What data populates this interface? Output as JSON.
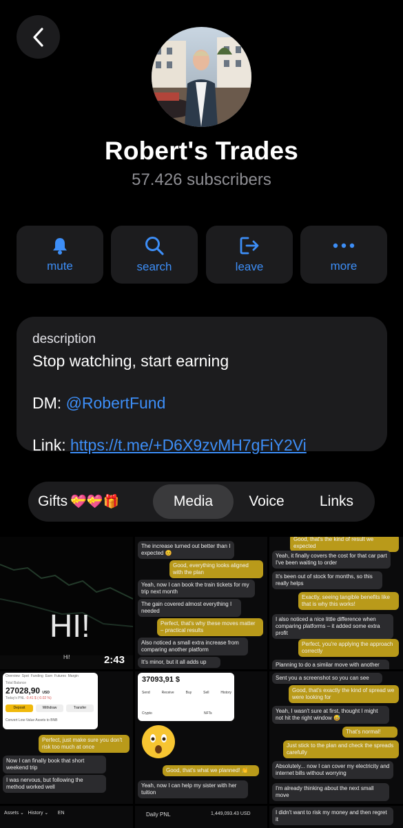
{
  "header": {
    "back_icon": "chevron-left-icon",
    "channel_name": "Robert's Trades",
    "subscribers": "57.426 subscribers"
  },
  "actions": [
    {
      "label": "mute",
      "icon": "bell-icon"
    },
    {
      "label": "search",
      "icon": "search-icon"
    },
    {
      "label": "leave",
      "icon": "leave-icon"
    },
    {
      "label": "more",
      "icon": "more-dots-icon"
    }
  ],
  "description": {
    "label": "description",
    "text": "Stop watching, start earning",
    "dm_label": "DM: ",
    "dm_handle": "@RobertFund",
    "link_label": "Link: ",
    "link_url": "https://t.me/+D6X9zvMH7gFiY2Vi"
  },
  "tabs": {
    "gifts": "Gifts",
    "gifts_emoji": "💝💝🎁",
    "media": "Media",
    "voice": "Voice",
    "links": "Links",
    "active": "Media"
  },
  "media": {
    "video": {
      "overlay_text": "HI!",
      "caption": "Hi!",
      "duration": "2:43"
    },
    "chat1": [
      "The increase turned out better than I expected 😊",
      "Good, everything looks aligned with the plan",
      "Yeah, now I can book the train tickets for my trip next month",
      "The gain covered almost everything I needed",
      "Perfect, that's why these moves matter – practical results",
      "Also noticed a small extra increase from comparing another platform",
      "It's minor, but it all adds up"
    ],
    "chat2": [
      "Good, that's the kind of result we expected",
      "Yeah, it finally covers the cost for that car part I've been waiting to order",
      "It's been out of stock for months, so this really helps",
      "Exactly, seeing tangible benefits like that is why this works!",
      "I also noticed a nice little difference when comparing platforms – it added some extra profit",
      "Perfect, you're applying the approach correctly",
      "Planning to do a similar move with another coin soon"
    ],
    "exchange": {
      "tabs": [
        "Overview",
        "Spot",
        "Funding",
        "Earn",
        "Futures",
        "Margin"
      ],
      "balance_label": "Total Balance",
      "balance": "27028,90",
      "balance_unit": "USD",
      "pnl_label": "Today's PNL",
      "pnl": "-0.41 $ (-0.02 %)",
      "buttons": [
        "Deposit",
        "Withdraw",
        "Transfer"
      ],
      "note": "Convert Low-Value Assets to BNB"
    },
    "chat3": [
      "Perfect, just make sure you don't risk too much at once",
      "Now I can finally book that short weekend trip",
      "I was nervous, but following the method worked well"
    ],
    "wallet": {
      "balance": "37093,91 $",
      "actions": [
        "Send",
        "Receive",
        "Buy",
        "Sell",
        "History"
      ],
      "tabs": [
        "Crypto",
        "NFTs"
      ]
    },
    "chat4": [
      "Good, that's what we planned! 👏",
      "Yeah, now I can help my sister with her tuition"
    ],
    "chat5": [
      "Sent you a screenshot so you can see",
      "Good, that's exactly the kind of spread we were looking for",
      "Yeah, I wasn't sure at first, thought I might not hit the right window 😅",
      "That's normal!",
      "Just stick to the plan and check the spreads carefully",
      "Absolutely... now I can cover my electricity and internet bills without worrying",
      "I'm already thinking about the next small move"
    ],
    "bottom": {
      "left": [
        "Assets",
        "History",
        "EN"
      ],
      "middle_label": "Daily PNL",
      "middle_value": "1,449,093.43 USD",
      "right": "I didn't want to risk my money and then regret it"
    }
  }
}
